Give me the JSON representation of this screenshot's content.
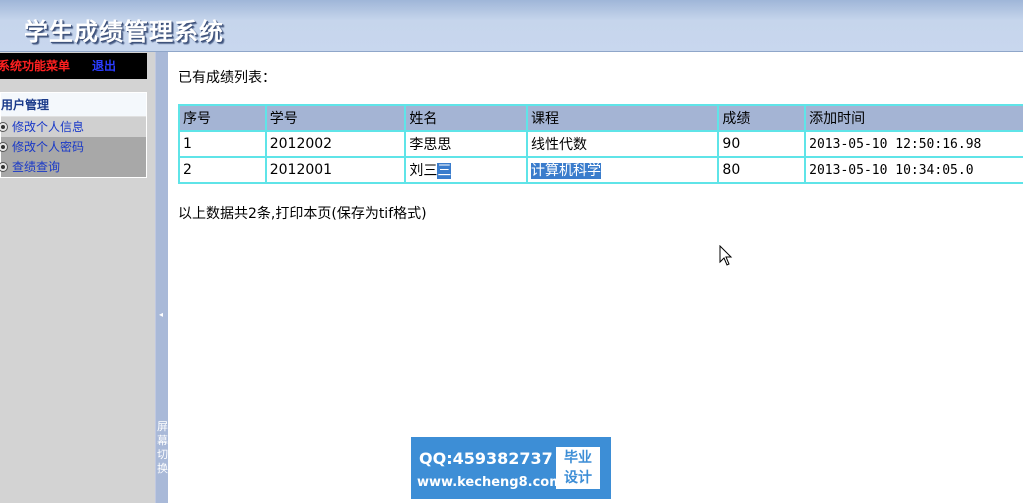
{
  "app": {
    "title": "学生成绩管理系统"
  },
  "sidebar": {
    "menu_label": "系统功能菜单",
    "logout_label": "退出",
    "section_title": "用户管理",
    "items": [
      {
        "label": "修改个人信息",
        "icon": "radio-bullet-icon"
      },
      {
        "label": "修改个人密码",
        "icon": "radio-bullet-icon"
      },
      {
        "label": "查绩查询",
        "icon": "radio-bullet-icon"
      }
    ]
  },
  "splitter": {
    "arrow": "◂",
    "chars": [
      "屏",
      "幕",
      "切",
      "换"
    ]
  },
  "main": {
    "heading": "已有成绩列表：",
    "table": {
      "columns": [
        "序号",
        "学号",
        "姓名",
        "课程",
        "成绩",
        "添加时间"
      ],
      "rows": [
        [
          "1",
          "2012002",
          "李思思",
          "线性代数",
          "90",
          "2013-05-10 12:50:16.98"
        ],
        [
          "2",
          "2012001",
          "刘三三",
          "计算机科学",
          "80",
          "2013-05-10 10:34:05.0"
        ]
      ],
      "selection": {
        "row2_name_plain": "刘三",
        "row2_name_selected": "三"
      }
    },
    "footer_note": "以上数据共2条,打印本页(保存为tif格式)"
  },
  "watermark": {
    "qq": "QQ:459382737",
    "url": "www.kecheng8.com",
    "badge_line1": "毕业",
    "badge_line2": "设计"
  },
  "colors": {
    "header": "#c6d5ec",
    "sidebar": "#d3d3d3",
    "table_header": "#a4b4d4",
    "table_border": "#5fe4e8",
    "selection": "#3a7ccc",
    "watermark": "#3d8ed6"
  }
}
